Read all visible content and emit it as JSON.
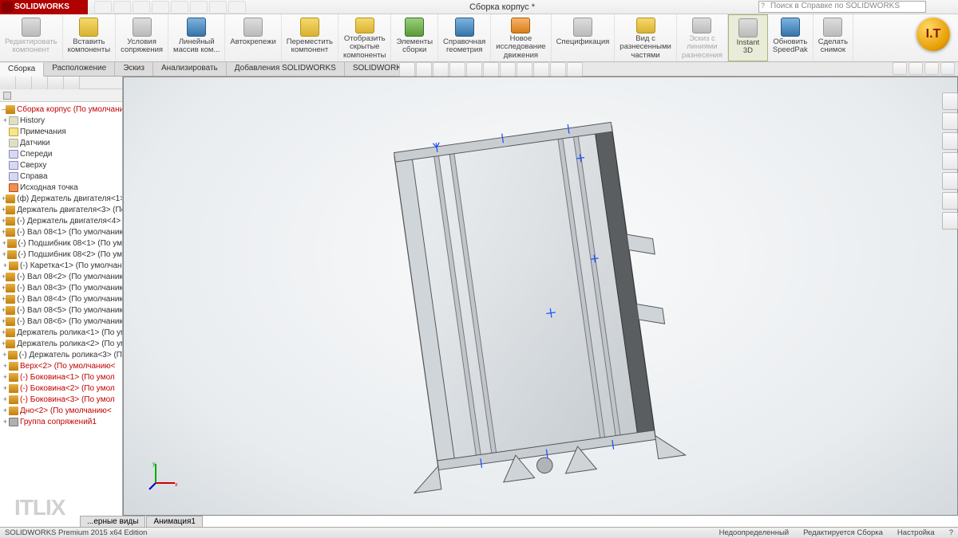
{
  "app": {
    "logo": "SOLIDWORKS",
    "doc_title": "Сборка корпус *",
    "search_placeholder": "Поиск в Справке по SOLIDWORKS"
  },
  "ribbon": [
    {
      "label": "Редактировать\nкомпонент",
      "ic": "ic-grey",
      "dis": true
    },
    {
      "label": "Вставить\nкомпоненты",
      "ic": "ic-yellow"
    },
    {
      "label": "Условия\nсопряжения",
      "ic": "ic-grey"
    },
    {
      "label": "Линейный\nмассив ком...",
      "ic": "ic-blue"
    },
    {
      "label": "Автокрепежи",
      "ic": "ic-grey"
    },
    {
      "label": "Переместить\nкомпонент",
      "ic": "ic-yellow"
    },
    {
      "label": "Отобразить\nскрытые\nкомпоненты",
      "ic": "ic-yellow"
    },
    {
      "label": "Элементы\nсборки",
      "ic": "ic-green"
    },
    {
      "label": "Справочная\nгеометрия",
      "ic": "ic-blue"
    },
    {
      "label": "Новое\nисследование\nдвижения",
      "ic": "ic-orange"
    },
    {
      "label": "Спецификация",
      "ic": "ic-grey"
    },
    {
      "label": "Вид с\nразнесенными\nчастями",
      "ic": "ic-yellow"
    },
    {
      "label": "Эскиз с\nлиниями\nразнесения",
      "ic": "ic-grey",
      "dis": true
    },
    {
      "label": "Instant\n3D",
      "ic": "ic-grey",
      "hl": true
    },
    {
      "label": "Обновить\nSpeedPak",
      "ic": "ic-blue"
    },
    {
      "label": "Сделать\nснимок",
      "ic": "ic-grey"
    }
  ],
  "tabs": [
    "Сборка",
    "Расположение",
    "Эскиз",
    "Анализировать",
    "Добавления SOLIDWORKS",
    "SOLIDWORKS MBD"
  ],
  "tree": [
    {
      "t": "Сборка корпус  (По умолчани",
      "c": "red",
      "ic": "asm",
      "e": "–"
    },
    {
      "t": "History",
      "c": "normal",
      "ic": "folder",
      "e": "+"
    },
    {
      "t": "Примечания",
      "c": "normal",
      "ic": "note",
      "e": ""
    },
    {
      "t": "Датчики",
      "c": "normal",
      "ic": "folder",
      "e": ""
    },
    {
      "t": "Спереди",
      "c": "normal",
      "ic": "plane",
      "e": ""
    },
    {
      "t": "Сверху",
      "c": "normal",
      "ic": "plane",
      "e": ""
    },
    {
      "t": "Справа",
      "c": "normal",
      "ic": "plane",
      "e": ""
    },
    {
      "t": "Исходная точка",
      "c": "normal",
      "ic": "origin",
      "e": ""
    },
    {
      "t": "(ф) Держатель двигателя<1>",
      "c": "normal",
      "ic": "part",
      "e": "+"
    },
    {
      "t": "Держатель двигателя<3>  (По",
      "c": "normal",
      "ic": "part",
      "e": "+"
    },
    {
      "t": "(-) Держатель двигателя<4>  (",
      "c": "normal",
      "ic": "part",
      "e": "+"
    },
    {
      "t": "(-) Вал 08<1>  (По умолчаник",
      "c": "normal",
      "ic": "part",
      "e": "+"
    },
    {
      "t": "(-) Подшибник 08<1>  (По ум",
      "c": "normal",
      "ic": "part",
      "e": "+"
    },
    {
      "t": "(-) Подшибник 08<2>  (По ум",
      "c": "normal",
      "ic": "part",
      "e": "+"
    },
    {
      "t": "(-) Каретка<1>  (По умолчан",
      "c": "normal",
      "ic": "part",
      "e": "+"
    },
    {
      "t": "(-) Вал 08<2>  (По умолчаник",
      "c": "normal",
      "ic": "part",
      "e": "+"
    },
    {
      "t": "(-) Вал 08<3>  (По умолчаник",
      "c": "normal",
      "ic": "part",
      "e": "+"
    },
    {
      "t": "(-) Вал 08<4>  (По умолчаник",
      "c": "normal",
      "ic": "part",
      "e": "+"
    },
    {
      "t": "(-) Вал 08<5>  (По умолчаник",
      "c": "normal",
      "ic": "part",
      "e": "+"
    },
    {
      "t": "(-) Вал 08<6>  (По умолчаник",
      "c": "normal",
      "ic": "part",
      "e": "+"
    },
    {
      "t": "Держатель ролика<1>  (По ум",
      "c": "normal",
      "ic": "part",
      "e": "+"
    },
    {
      "t": "Держатель ролика<2>  (По ум",
      "c": "normal",
      "ic": "part",
      "e": "+"
    },
    {
      "t": "(-) Держатель ролика<3>  (П",
      "c": "normal",
      "ic": "part",
      "e": "+"
    },
    {
      "t": "Верх<2>  (По умолчанию<",
      "c": "red",
      "ic": "part",
      "e": "+"
    },
    {
      "t": "(-) Боковина<1>  (По умол",
      "c": "red",
      "ic": "part",
      "e": "+"
    },
    {
      "t": "(-) Боковина<2>  (По умол",
      "c": "red",
      "ic": "part",
      "e": "+"
    },
    {
      "t": "(-) Боковина<3>  (По умол",
      "c": "red",
      "ic": "part",
      "e": "+"
    },
    {
      "t": "Дно<2>  (По умолчанию<",
      "c": "red",
      "ic": "part",
      "e": "+"
    },
    {
      "t": "Группа сопряжений1",
      "c": "red",
      "ic": "mate",
      "e": "+"
    }
  ],
  "bottom_tabs": [
    "...ерные виды",
    "Анимация1"
  ],
  "status": {
    "left": "SOLIDWORKS Premium 2015 x64 Edition",
    "r1": "Недоопределенный",
    "r2": "Редактируется Сборка",
    "r3": "Настройка"
  },
  "wm": {
    "itlix": "ITLIX",
    "it": "I.T"
  }
}
